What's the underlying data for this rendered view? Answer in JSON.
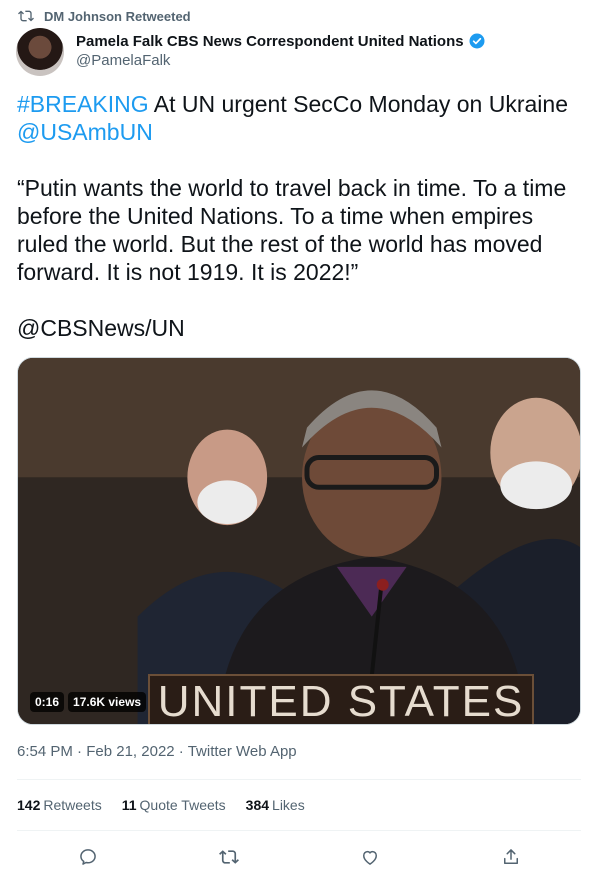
{
  "retweet_header": {
    "label": "DM Johnson Retweeted",
    "icon": "retweet-icon"
  },
  "author": {
    "name": "Pamela Falk CBS News Correspondent United Nations",
    "handle": "@PamelaFalk",
    "verified": true
  },
  "tweet": {
    "hashtag": "#BREAKING",
    "line1_rest": " At UN urgent SecCo Monday on Ukraine",
    "mention": "@USAmbUN",
    "quote": "“Putin wants the world to travel back in time. To a time before the United Nations. To a time when empires ruled the world. But the rest of the world has moved forward. It is not 1919. It is 2022!”",
    "footer_mention": "@CBSNews/UN"
  },
  "media": {
    "duration": "0:16",
    "views": "17.6K views",
    "nameplate": "UNITED STATES"
  },
  "meta": {
    "time": "6:54 PM",
    "date": "Feb 21, 2022",
    "source": "Twitter Web App",
    "separator": "·"
  },
  "stats": {
    "retweets": {
      "count": "142",
      "label": "Retweets"
    },
    "quotes": {
      "count": "11",
      "label": "Quote Tweets"
    },
    "likes": {
      "count": "384",
      "label": "Likes"
    }
  },
  "colors": {
    "accent": "#1d9bf0",
    "text": "#0f1419",
    "secondary": "#536471",
    "divider": "#eff3f4"
  },
  "actions": [
    "reply-icon",
    "retweet-icon",
    "like-icon",
    "share-icon"
  ]
}
